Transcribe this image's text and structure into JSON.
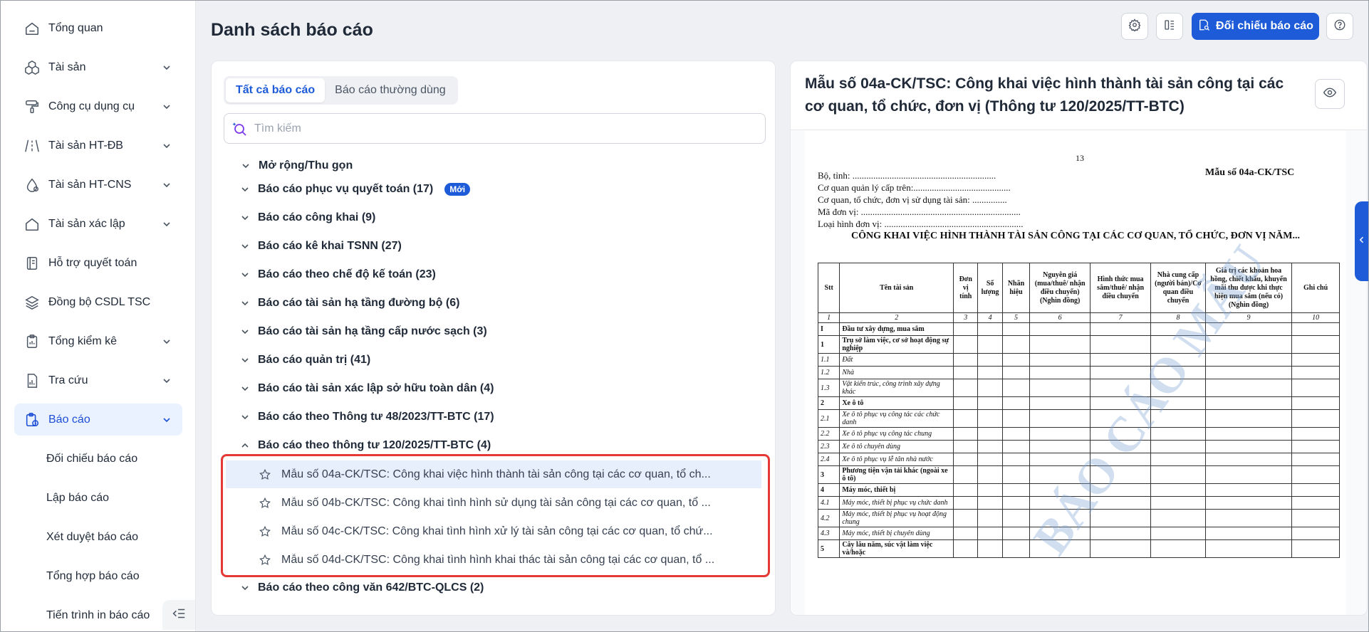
{
  "sidebar": {
    "items": [
      {
        "label": "Tổng quan",
        "icon": "home-icon",
        "has_children": false
      },
      {
        "label": "Tài sản",
        "icon": "cubes-icon",
        "has_children": true
      },
      {
        "label": "Công cụ dụng cụ",
        "icon": "paint-roller-icon",
        "has_children": true
      },
      {
        "label": "Tài sản HT-ĐB",
        "icon": "road-icon",
        "has_children": true
      },
      {
        "label": "Tài sản HT-CNS",
        "icon": "water-drop-icon",
        "has_children": true
      },
      {
        "label": "Tài sản xác lập",
        "icon": "home-icon",
        "has_children": true
      },
      {
        "label": "Hỗ trợ quyết toán",
        "icon": "notebook-icon",
        "has_children": false
      },
      {
        "label": "Đồng bộ CSDL TSC",
        "icon": "layers-icon",
        "has_children": false
      },
      {
        "label": "Tổng kiểm kê",
        "icon": "clipboard-icon",
        "has_children": true
      },
      {
        "label": "Tra cứu",
        "icon": "chart-doc-icon",
        "has_children": true
      },
      {
        "label": "Báo cáo",
        "icon": "report-icon",
        "has_children": true,
        "active": true
      }
    ],
    "sub_items": [
      "Đối chiếu báo cáo",
      "Lập báo cáo",
      "Xét duyệt báo cáo",
      "Tổng hợp báo cáo",
      "Tiến trình in báo cáo"
    ]
  },
  "header": {
    "title": "Danh sách báo cáo",
    "primary_button": "Đối chiếu báo cáo"
  },
  "list": {
    "tabs": [
      "Tất cả báo cáo",
      "Báo cáo thường dùng"
    ],
    "search_placeholder": "Tìm kiếm",
    "expand_collapse": "Mở rộng/Thu gọn",
    "groups": [
      {
        "label": "Báo cáo phục vụ quyết toán (17)",
        "badge": "Mới"
      },
      {
        "label": "Báo cáo công khai (9)"
      },
      {
        "label": "Báo cáo kê khai TSNN (27)"
      },
      {
        "label": "Báo cáo theo chế độ kế toán (23)"
      },
      {
        "label": "Báo cáo tài sản hạ tầng đường bộ (6)"
      },
      {
        "label": "Báo cáo tài sản hạ tầng cấp nước sạch (3)"
      },
      {
        "label": "Báo cáo quản trị (41)"
      },
      {
        "label": "Báo cáo tài sản xác lập sở hữu toàn dân (4)"
      },
      {
        "label": "Báo cáo theo Thông tư 48/2023/TT-BTC (17)"
      },
      {
        "label": "Báo cáo theo thông tư 120/2025/TT-BTC (4)",
        "expanded": true
      }
    ],
    "leaves": [
      "Mẫu số 04a-CK/TSC: Công khai việc hình thành tài sản công tại các cơ quan, tổ ch...",
      "Mẫu số 04b-CK/TSC: Công khai tình hình sử dụng tài sản công tại các cơ quan, tổ ...",
      "Mẫu số 04c-CK/TSC: Công khai tình hình xử lý tài sản công tại các cơ quan, tổ chứ...",
      "Mẫu số 04d-CK/TSC: Công khai tình hình khai thác tài sản công tại các cơ quan, tổ ..."
    ],
    "last_group": "Báo cáo theo công văn 642/BTC-QLCS (2)"
  },
  "preview": {
    "title": "Mẫu số 04a-CK/TSC: Công khai việc hình thành tài sản công tại các cơ quan, tổ chức, đơn vị (Thông tư 120/2025/TT-BTC)",
    "doc": {
      "page_no": "13",
      "form_code": "Mẫu số 04a-CK/TSC",
      "meta": [
        "Bộ, tỉnh: ..............................................................",
        "Cơ quan quản lý cấp trên:..........................................",
        "Cơ quan, tổ chức, đơn vị sử dụng tài sản: ...............",
        "Mã đơn vị: .....................................................................",
        "Loại hình đơn vị: ............................................................"
      ],
      "heading": "CÔNG KHAI VIỆC HÌNH THÀNH TÀI SẢN CÔNG TẠI CÁC CƠ QUAN, TỔ CHỨC, ĐƠN VỊ NĂM...",
      "watermark": "BÁO CÁO MẪU",
      "columns": [
        "Stt",
        "Tên tài sản",
        "Đơn vị tính",
        "Số lượng",
        "Nhãn hiệu",
        "Nguyên giá (mua/thuê/ nhận điều chuyển) (Nghìn đồng)",
        "Hình thức mua sắm/thuê/ nhận điều chuyển",
        "Nhà cung cấp (người bán)/Cơ quan điều chuyển",
        "Giá trị các khoản hoa hồng, chiết khấu, khuyến mãi thu được khi thực hiện mua sắm (nếu có) (Nghìn đồng)",
        "Ghi chú"
      ],
      "index_row": [
        "1",
        "2",
        "3",
        "4",
        "5",
        "6",
        "7",
        "8",
        "9",
        "10"
      ],
      "rows": [
        {
          "stt": "I",
          "name": "Đầu tư xây dựng, mua sắm",
          "kind": "sec"
        },
        {
          "stt": "1",
          "name": "Trụ sở làm việc, cơ sở hoạt động sự nghiệp",
          "kind": "sec"
        },
        {
          "stt": "1.1",
          "name": "Đất",
          "kind": "sub"
        },
        {
          "stt": "1.2",
          "name": "Nhà",
          "kind": "sub"
        },
        {
          "stt": "1.3",
          "name": "Vật kiến trúc, công trình xây dựng khác",
          "kind": "sub"
        },
        {
          "stt": "2",
          "name": "Xe ô tô",
          "kind": "sec"
        },
        {
          "stt": "2.1",
          "name": "Xe ô tô phục vụ công tác các chức danh",
          "kind": "sub"
        },
        {
          "stt": "2.2",
          "name": "Xe ô tô phục vụ công tác chung",
          "kind": "sub"
        },
        {
          "stt": "2.3",
          "name": "Xe ô tô chuyên dùng",
          "kind": "sub"
        },
        {
          "stt": "2.4",
          "name": "Xe ô tô phục vụ lễ tân nhà nước",
          "kind": "sub"
        },
        {
          "stt": "3",
          "name": "Phương tiện vận tải khác (ngoài xe ô tô)",
          "kind": "sec"
        },
        {
          "stt": "4",
          "name": "Máy móc, thiết bị",
          "kind": "sec"
        },
        {
          "stt": "4.1",
          "name": "Máy móc, thiết bị phục vụ chức danh",
          "kind": "sub"
        },
        {
          "stt": "4.2",
          "name": "Máy móc, thiết bị phục vụ hoạt động chung",
          "kind": "sub"
        },
        {
          "stt": "4.3",
          "name": "Máy móc, thiết bị chuyên dùng",
          "kind": "sub"
        },
        {
          "stt": "5",
          "name": "Cây lâu năm, súc vật làm việc và/hoặc",
          "kind": "sec"
        }
      ]
    }
  },
  "colors": {
    "accent": "#1d5bd8",
    "active_bg": "#eaf1ff",
    "highlight": "#e53935"
  }
}
